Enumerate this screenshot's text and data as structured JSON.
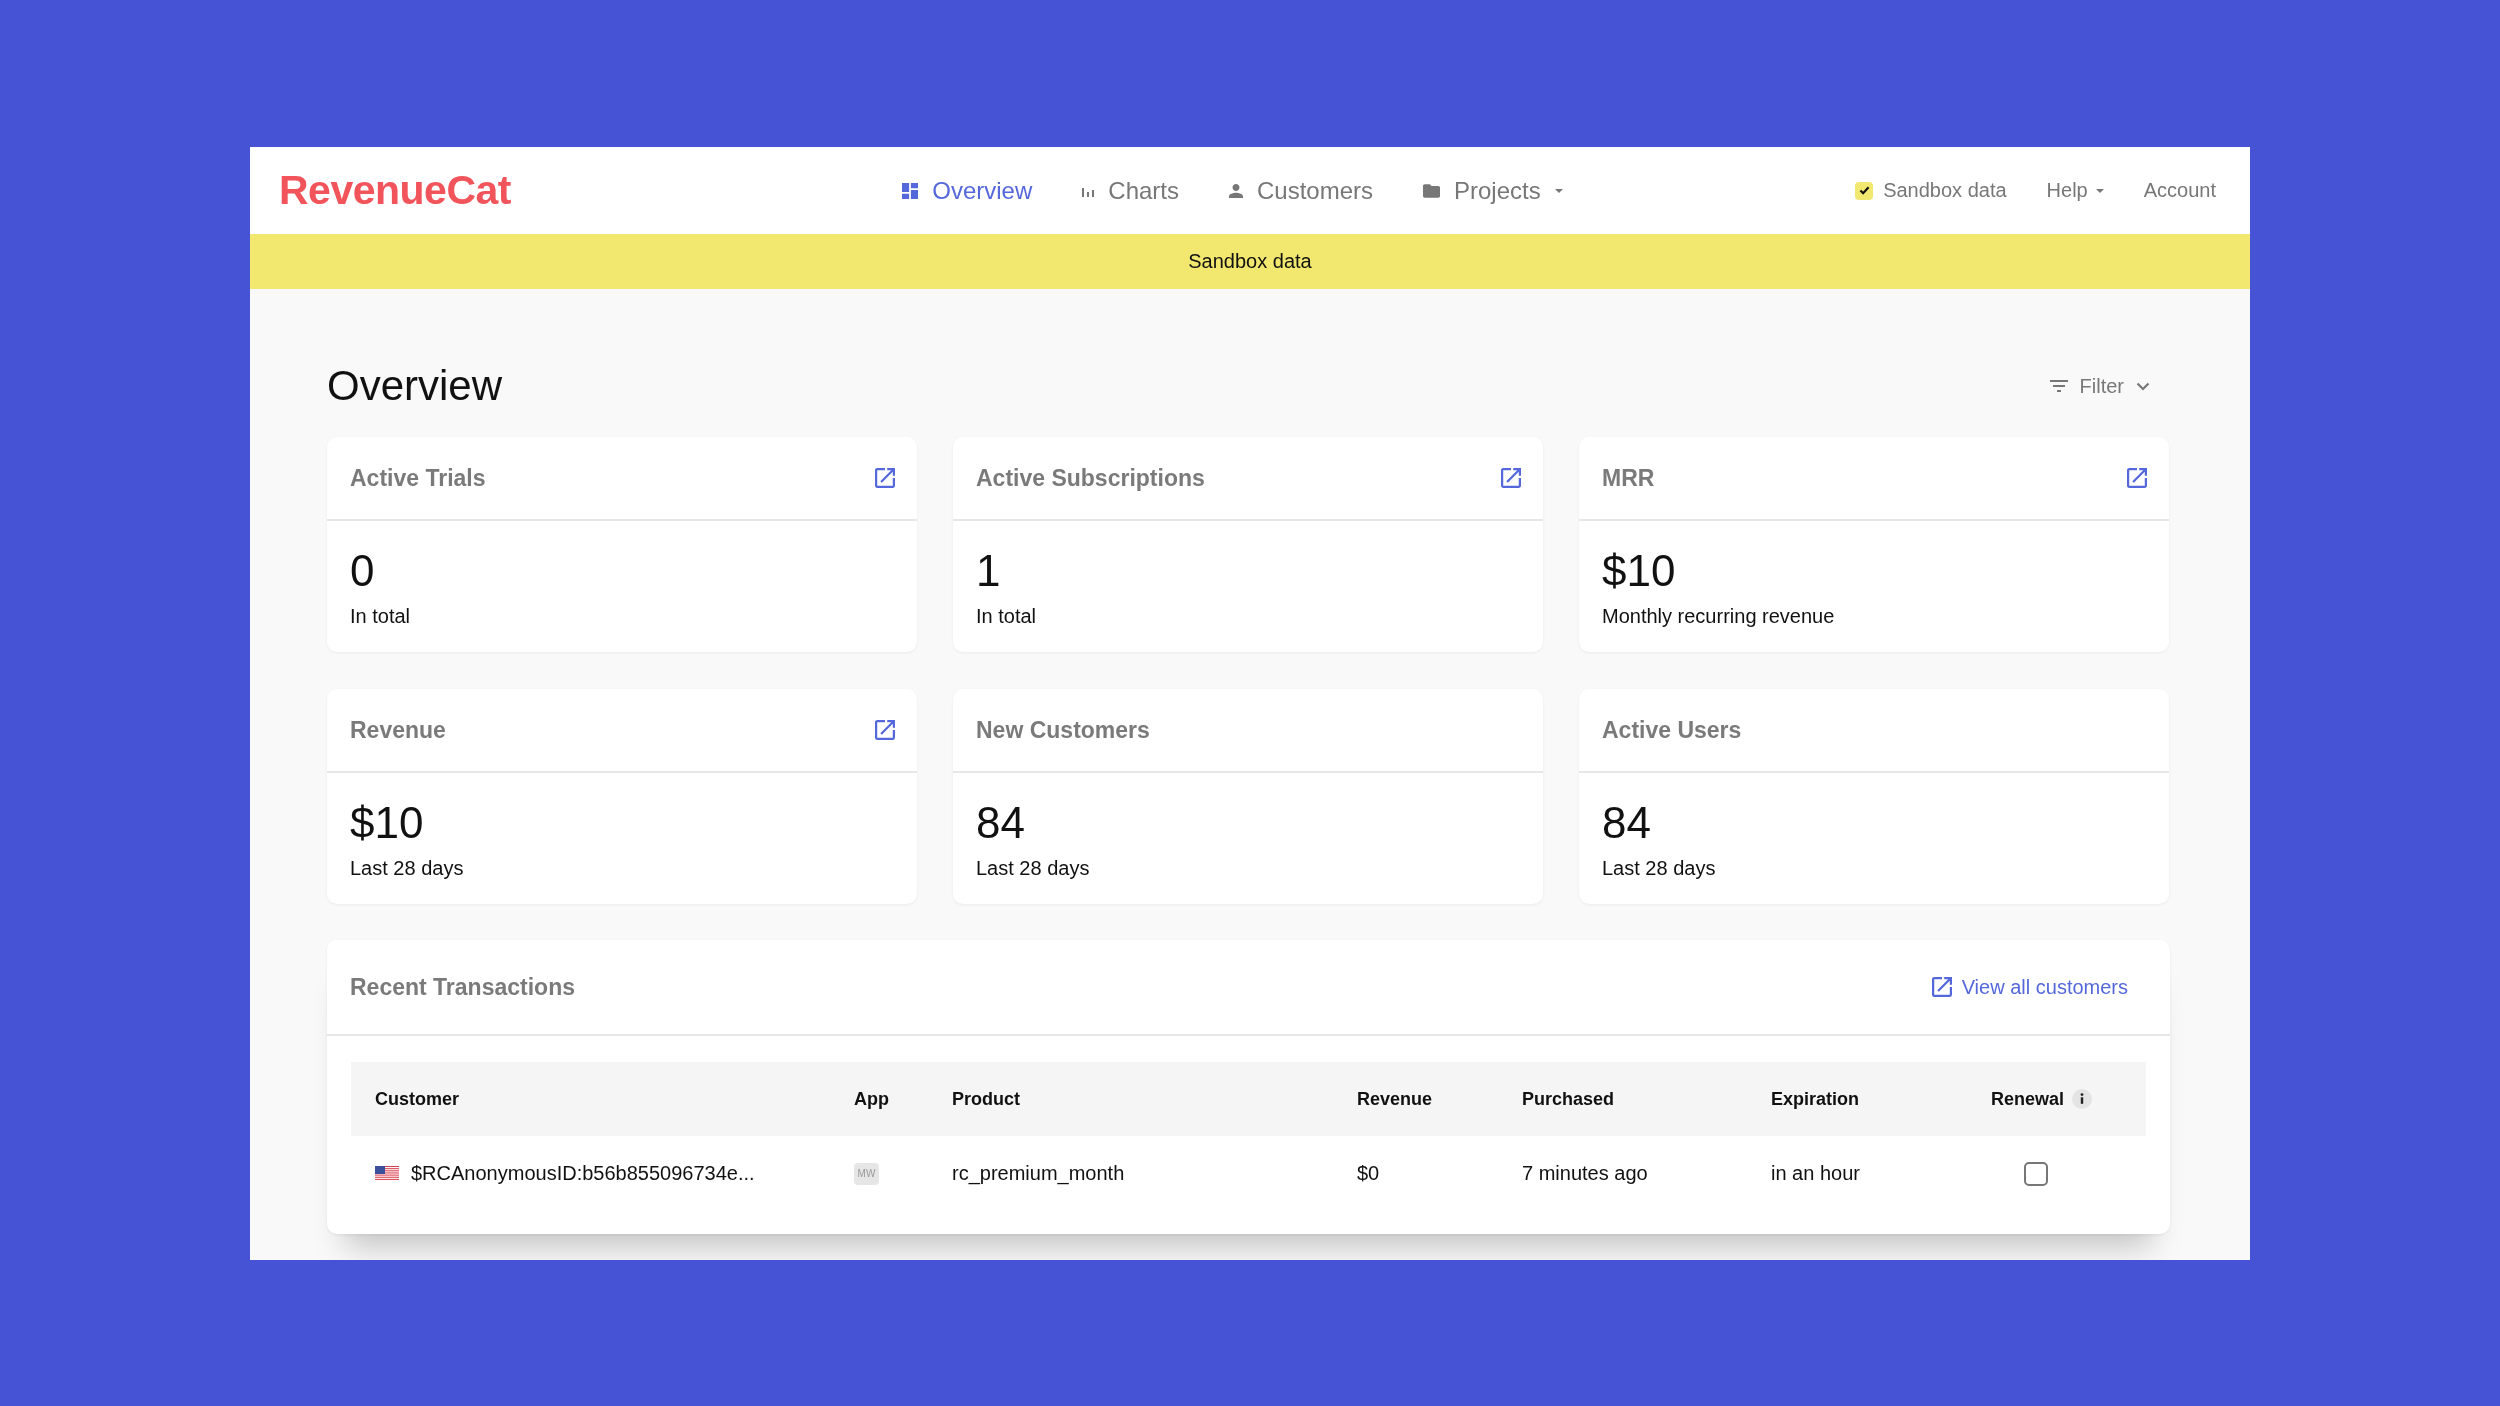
{
  "app": {
    "logo": "RevenueCat"
  },
  "nav": [
    {
      "label": "Overview",
      "selected": true,
      "dropdown": false
    },
    {
      "label": "Charts",
      "selected": false,
      "dropdown": false
    },
    {
      "label": "Customers",
      "selected": false,
      "dropdown": false
    },
    {
      "label": "Projects",
      "selected": false,
      "dropdown": true
    }
  ],
  "toolbar": {
    "sandbox": {
      "label": "Sandbox data",
      "checked": true
    },
    "menus": [
      {
        "label": "Help",
        "dropdown": true
      },
      {
        "label": "Account",
        "dropdown": false
      }
    ]
  },
  "banner": {
    "text": "Sandbox data"
  },
  "page": {
    "title": "Overview",
    "filter": "Filter"
  },
  "metrics": [
    {
      "title": "Active Trials",
      "value": "0",
      "caption": "In total",
      "link": true
    },
    {
      "title": "Active Subscriptions",
      "value": "1",
      "caption": "In total",
      "link": true
    },
    {
      "title": "MRR",
      "value": "$10",
      "caption": "Monthly recurring revenue",
      "link": true
    },
    {
      "title": "Revenue",
      "value": "$10",
      "caption": "Last 28 days",
      "link": true
    },
    {
      "title": "New Customers",
      "value": "84",
      "caption": "Last 28 days",
      "link": false
    },
    {
      "title": "Active Users",
      "value": "84",
      "caption": "Last 28 days",
      "link": false
    }
  ],
  "transactions": {
    "title": "Recent Transactions",
    "link": "View all customers",
    "columns": [
      {
        "label": "Customer",
        "info": false
      },
      {
        "label": "App",
        "info": false
      },
      {
        "label": "Product",
        "info": false
      },
      {
        "label": "Revenue",
        "info": false
      },
      {
        "label": "Purchased",
        "info": false
      },
      {
        "label": "Expiration",
        "info": false
      },
      {
        "label": "Renewal",
        "info": true
      }
    ],
    "rows": [
      {
        "customer": "$RCAnonymousID:b56b855096734e...",
        "app": "MW",
        "product": "rc_premium_month",
        "revenue": "$0",
        "purchased": "7 minutes ago",
        "expiration": "in an hour",
        "renewal": false
      }
    ]
  }
}
